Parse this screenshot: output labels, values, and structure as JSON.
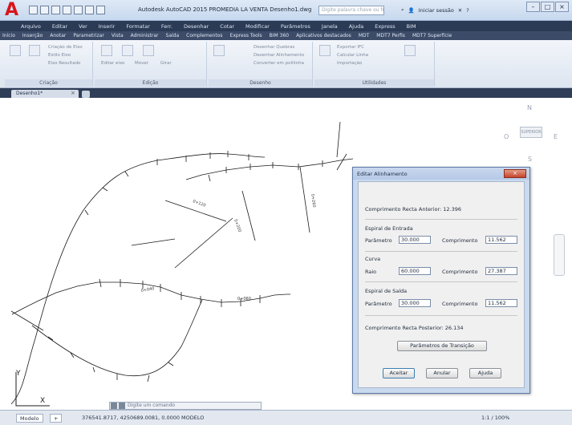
{
  "app": {
    "title": "Autodesk AutoCAD 2015  PROMEDIA LA VENTA  Desenho1.dwg",
    "search_placeholder": "Digite palavra chave ou frase",
    "signin_label": "Iniciar sessão",
    "help_label": "?"
  },
  "window_buttons": [
    "–",
    "□",
    "×"
  ],
  "menu": [
    "Arquivo",
    "Editar",
    "Ver",
    "Inserir",
    "Formatar",
    "Ferr.",
    "Desenhar",
    "Cotar",
    "Modificar",
    "Parâmetros",
    "Janela",
    "Ajuda",
    "Express",
    "BIM"
  ],
  "ribbon_tabs": [
    "Início",
    "Inserção",
    "Anotar",
    "Parametrizar",
    "Vista",
    "Administrar",
    "Saída",
    "Complementos",
    "Express Tools",
    "BIM 360",
    "Aplicativos destacados",
    "MDT",
    "MDT7 Perfis",
    "MDT7 Superfície"
  ],
  "ribbon_groups": [
    {
      "label": "Criação",
      "tools": [
        "Criação de Eixo",
        "Estilo Eixo",
        "Eixo Resultado"
      ]
    },
    {
      "label": "Edição",
      "tools": [
        "Editar eixo",
        "Mover",
        "Girar"
      ]
    },
    {
      "label": "Desenho",
      "tools": [
        "Desenhar Quebras",
        "Desenhar Alinhamento",
        "Converter em polilinha"
      ]
    },
    {
      "label": "Utilidades",
      "tools": [
        "Exportar IFC",
        "Calcular Linha",
        "Importação"
      ]
    }
  ],
  "document_tab": "Desenho1*",
  "dialog": {
    "title": "Editar Alinhamento",
    "close_label": "×",
    "reta_anterior": "Comprimento Recta Anterior: 12.396",
    "espiral_entrada": {
      "heading": "Espiral de Entrada",
      "param_label": "Parâmetro",
      "param_value": "30.000",
      "comp_label": "Comprimento",
      "comp_value": "11.562"
    },
    "curva": {
      "heading": "Curva",
      "raio_label": "Raio",
      "raio_value": "60.000",
      "comp_label": "Comprimento",
      "comp_value": "27.387"
    },
    "espiral_saida": {
      "heading": "Espiral de Saída",
      "param_label": "Parâmetro",
      "param_value": "30.000",
      "comp_label": "Comprimento",
      "comp_value": "11.562"
    },
    "reta_posterior": "Comprimento Recta Posterior: 26.134",
    "pick_button": "Parâmetros de Transição",
    "ok_button": "Aceitar",
    "cancel_button": "Anular",
    "help_button": "Ajuda"
  },
  "command_line": {
    "placeholder": "Digite um comando"
  },
  "viewcube": {
    "north": "N",
    "face": "SUPERIOR",
    "west": "O",
    "east": "E",
    "south": "S"
  },
  "status_bar": {
    "tab_model": "Modelo",
    "tab_layout": "+",
    "coords": "376541.8717, 4250689.0081, 0.0000  MODELO",
    "right": "1:1 / 100%"
  },
  "colors": {
    "title_bar": "#c7d8ee",
    "menu_bar": "#2b3a55",
    "dialog_close": "#c7452b"
  }
}
